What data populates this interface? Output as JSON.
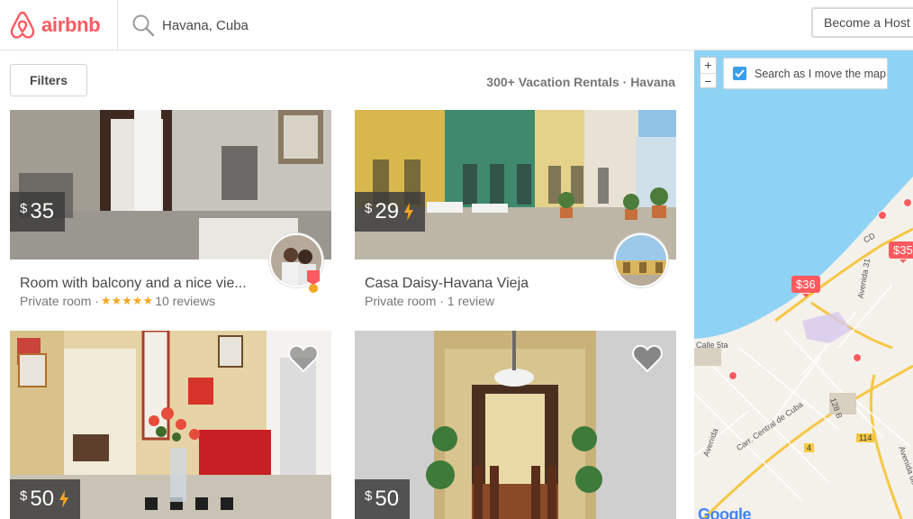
{
  "header": {
    "brand": "airbnb",
    "search_value": "Havana, Cuba",
    "host_button": "Become a Host"
  },
  "filterbar": {
    "filters_label": "Filters",
    "rental_count": "300+ Vacation Rentals · Havana"
  },
  "listings": [
    {
      "currency": "$",
      "price": "35",
      "instant_book": false,
      "title": "Room with balcony and a nice vie...",
      "room_type": "Private room ·",
      "stars": "★★★★★",
      "reviews": "10 reviews",
      "superhost": true
    },
    {
      "currency": "$",
      "price": "29",
      "instant_book": true,
      "title": "Casa Daisy-Havana Vieja",
      "room_type": "Private room ·",
      "stars": "",
      "reviews": "1 review",
      "superhost": false
    },
    {
      "currency": "$",
      "price": "50",
      "instant_book": true
    },
    {
      "currency": "$",
      "price": "50",
      "instant_book": false
    }
  ],
  "map": {
    "zoom_in": "+",
    "zoom_out": "−",
    "search_as_move": "Search as I move the map",
    "search_as_move_checked": true,
    "pins": [
      {
        "label": "$36"
      },
      {
        "label": "$35"
      }
    ],
    "street_labels": [
      "CD",
      "Avenida 31",
      "Calle 5ta",
      "Carr. Central de Cuba",
      "128 B",
      "114",
      "4",
      "Avenida de la",
      "Avenida"
    ],
    "attribution": "Google"
  },
  "colors": {
    "brand": "#ff5a5f",
    "star": "#f5a623",
    "water": "#8fd3f4",
    "land": "#f4f1ea",
    "checkbox": "#3b9fe8"
  }
}
